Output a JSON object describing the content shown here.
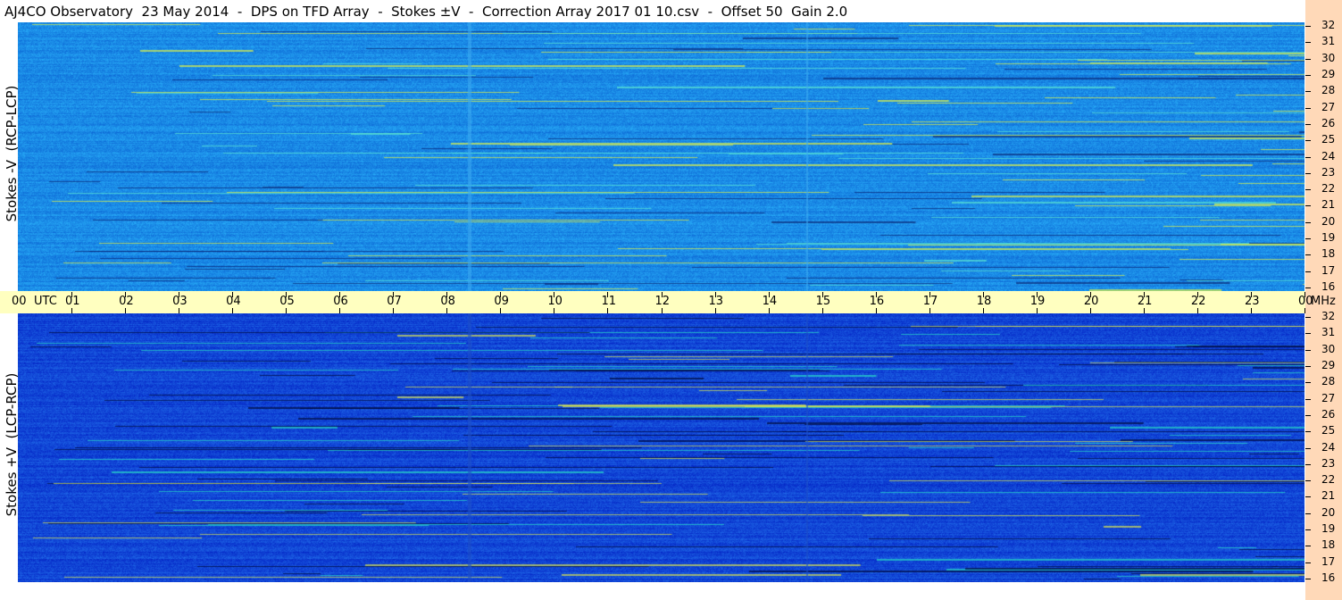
{
  "title": "AJ4CO Observatory  23 May 2014  -  DPS on TFD Array  -  Stokes ±V  -  Correction Array 2017 01 10.csv  -  Offset 50  Gain 2.0",
  "panels": [
    {
      "ylabel": "Stokes -V  (RCP-LCP)",
      "base_color": "#1a8ae6"
    },
    {
      "ylabel": "Stokes +V  (LCP-RCP)",
      "base_color": "#1146d6"
    }
  ],
  "time_axis": {
    "labels": [
      "00",
      "UTC",
      "01",
      "02",
      "03",
      "04",
      "05",
      "06",
      "07",
      "08",
      "09",
      "10",
      "11",
      "12",
      "13",
      "14",
      "15",
      "16",
      "17",
      "18",
      "19",
      "20",
      "21",
      "22",
      "23",
      "00",
      "MHz"
    ]
  },
  "chart_data": {
    "type": "heatmap",
    "xlabel": "UTC",
    "ylabel": "MHz",
    "x_hours": [
      0,
      1,
      2,
      3,
      4,
      5,
      6,
      7,
      8,
      9,
      10,
      11,
      12,
      13,
      14,
      15,
      16,
      17,
      18,
      19,
      20,
      21,
      22,
      23,
      24
    ],
    "y_mhz": [
      16,
      17,
      18,
      19,
      20,
      21,
      22,
      23,
      24,
      25,
      26,
      27,
      28,
      29,
      30,
      31,
      32
    ],
    "series": [
      {
        "name": "Stokes -V  (RCP-LCP)"
      },
      {
        "name": "Stokes +V  (LCP-RCP)"
      }
    ],
    "colors": {
      "top_background": "#1a8ae6",
      "bottom_background": "#1146d6",
      "time_bar": "#ffffc0",
      "freq_axis": "#ffd9b8"
    }
  },
  "freq_labels": [
    "32",
    "31",
    "30",
    "29",
    "28",
    "27",
    "26",
    "25",
    "24",
    "23",
    "22",
    "21",
    "20",
    "19",
    "18",
    "17",
    "16"
  ]
}
